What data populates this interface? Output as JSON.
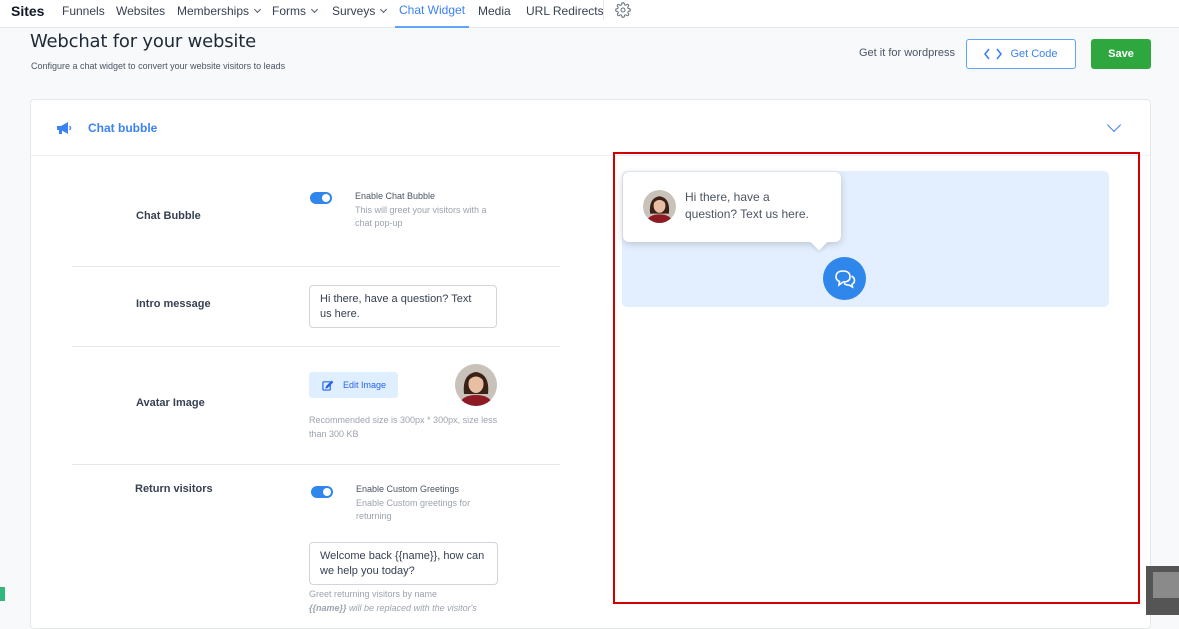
{
  "nav": {
    "brand": "Sites",
    "items": [
      {
        "label": "Funnels"
      },
      {
        "label": "Websites"
      },
      {
        "label": "Memberships"
      },
      {
        "label": "Forms"
      },
      {
        "label": "Surveys"
      },
      {
        "label": "Chat Widget"
      },
      {
        "label": "Media"
      },
      {
        "label": "URL Redirects"
      }
    ],
    "active": "Chat Widget",
    "settings_icon": "gear-icon"
  },
  "header": {
    "title": "Webchat for your website",
    "subtitle": "Configure a chat widget to convert your website visitors to leads",
    "wordpress_link": "Get it for wordpress",
    "get_code_label": "Get Code",
    "save_label": "Save"
  },
  "section": {
    "title": "Chat bubble",
    "icon": "megaphone-icon"
  },
  "settings": {
    "chat_bubble": {
      "label": "Chat Bubble",
      "toggle_title": "Enable Chat Bubble",
      "toggle_desc": "This will greet your visitors with a chat pop-up",
      "enabled": true
    },
    "intro": {
      "label": "Intro message",
      "value": "Hi there, have a question? Text us here."
    },
    "avatar": {
      "label": "Avatar Image",
      "edit_label": "Edit Image",
      "help": "Recommended size is 300px * 300px, size less than 300 KB"
    },
    "return_visitors": {
      "label": "Return visitors",
      "toggle_title": "Enable Custom Greetings",
      "toggle_desc": "Enable Custom greetings for returning",
      "enabled": true,
      "greeting": "Welcome back {{name}}, how can we help you today?",
      "help_line1": "Greet returning visitors by name",
      "help_code": "{{name}}",
      "help_line2": " will be replaced with the visitor's"
    }
  },
  "preview": {
    "bubble_text": "Hi there, have a question? Text us here.",
    "highlight_color": "#d30000",
    "accent_color": "#2f86eb"
  }
}
